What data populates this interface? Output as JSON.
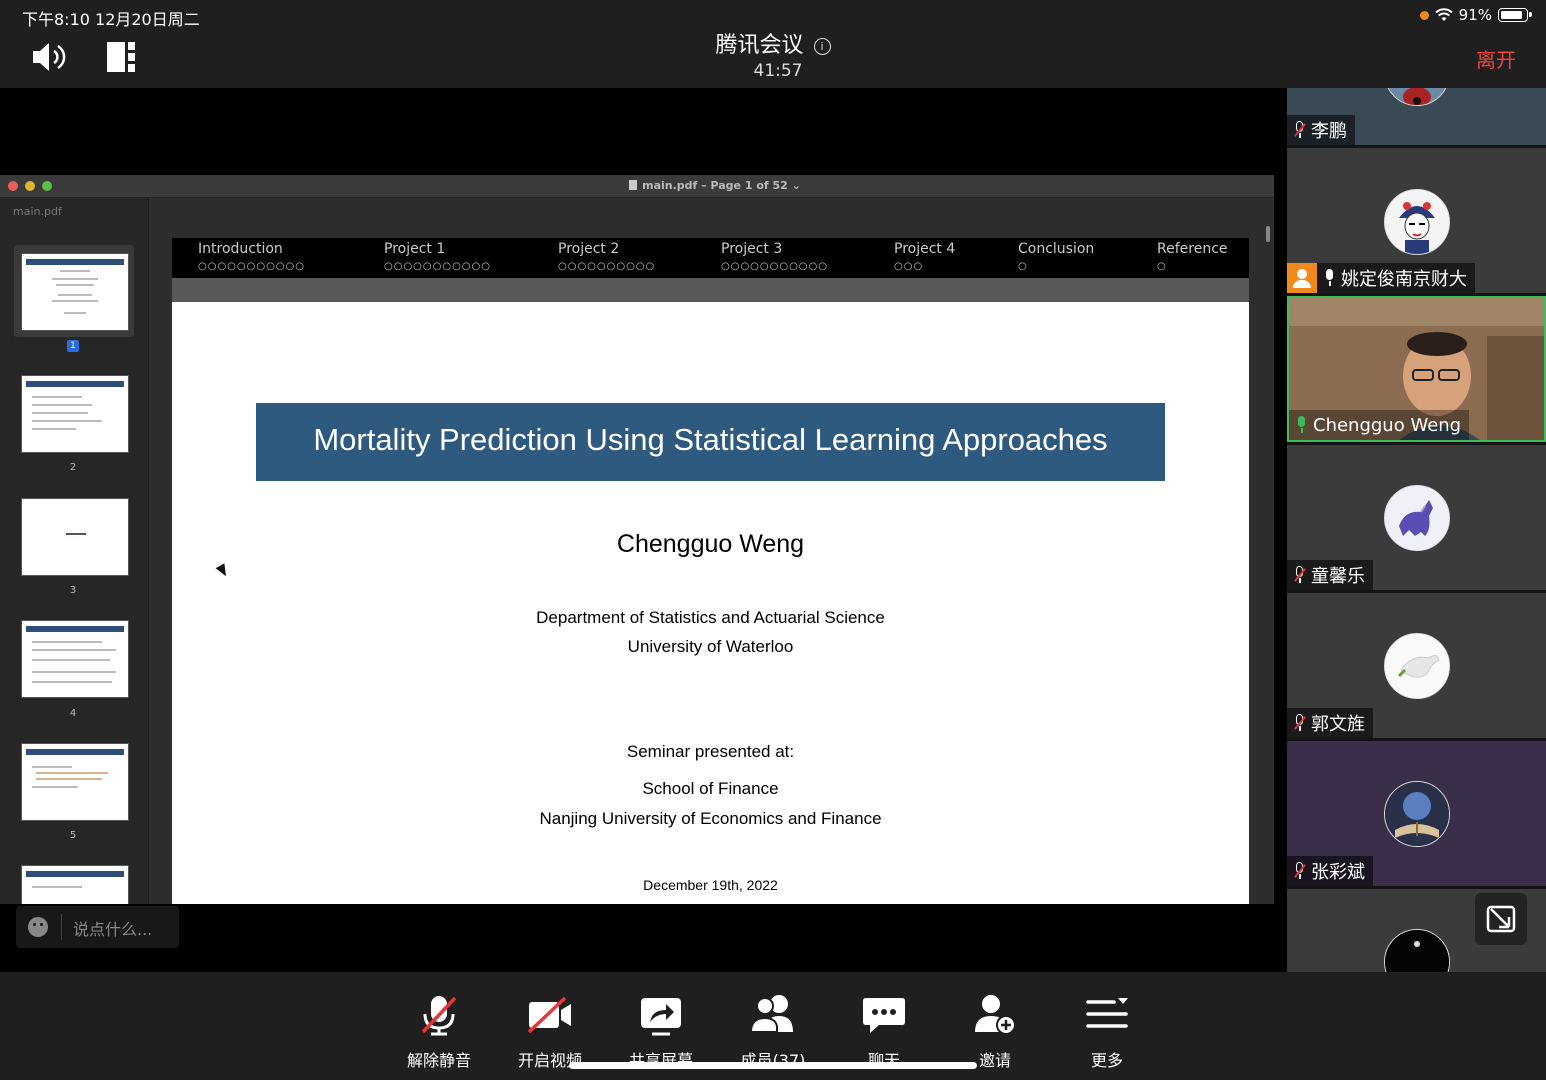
{
  "status_bar": {
    "time_date": "下午8:10  12月20日周二",
    "battery": "91%",
    "battery_level": 0.91
  },
  "header": {
    "title": "腾讯会议",
    "timer": "41:57",
    "leave_label": "离开"
  },
  "shared_window": {
    "sidebar_title": "main.pdf",
    "doc_title": "main.pdf – Page 1 of 52 ⌄",
    "thumbnails": [
      {
        "num": "1",
        "selected": true
      },
      {
        "num": "2"
      },
      {
        "num": "3"
      },
      {
        "num": "4"
      },
      {
        "num": "5"
      }
    ]
  },
  "slide": {
    "nav": [
      {
        "label": "Introduction",
        "dots": "○○○○○○○○○○○"
      },
      {
        "label": "Project 1",
        "dots": "○○○○○○○○○○○"
      },
      {
        "label": "Project 2",
        "dots": "○○○○○○○○○○"
      },
      {
        "label": "Project 3",
        "dots": "○○○○○○○○○○○"
      },
      {
        "label": "Project 4",
        "dots": "○○○"
      },
      {
        "label": "Conclusion",
        "dots": "○"
      },
      {
        "label": "Reference",
        "dots": "○"
      }
    ],
    "title": "Mortality Prediction Using Statistical Learning Approaches",
    "author": "Chengguo Weng",
    "affiliation_1": "Department of Statistics and Actuarial Science",
    "affiliation_2": "University of Waterloo",
    "seminar_label": "Seminar presented at:",
    "venue_1": "School of Finance",
    "venue_2": "Nanjing University of Economics and Finance",
    "date": "December 19th, 2022"
  },
  "chat": {
    "placeholder": "说点什么..."
  },
  "participants": [
    {
      "name": "李鹏",
      "mic": "muted"
    },
    {
      "name": "姚定俊南京财大",
      "mic": "on",
      "host": true
    },
    {
      "name": "Chengguo Weng",
      "mic": "speaking",
      "video": true
    },
    {
      "name": "童馨乐",
      "mic": "muted"
    },
    {
      "name": "郭文旌",
      "mic": "muted"
    },
    {
      "name": "张彩斌",
      "mic": "muted"
    }
  ],
  "toolbar": {
    "unmute": "解除静音",
    "video": "开启视频",
    "share": "共享屏幕",
    "members": "成员(37)",
    "chat": "聊天",
    "invite": "邀请",
    "more": "更多"
  },
  "colors": {
    "accent_green": "#3fbc5a",
    "leave_red": "#f24343",
    "slide_title_bg": "#2e5a80",
    "host_orange": "#f08a1c"
  }
}
